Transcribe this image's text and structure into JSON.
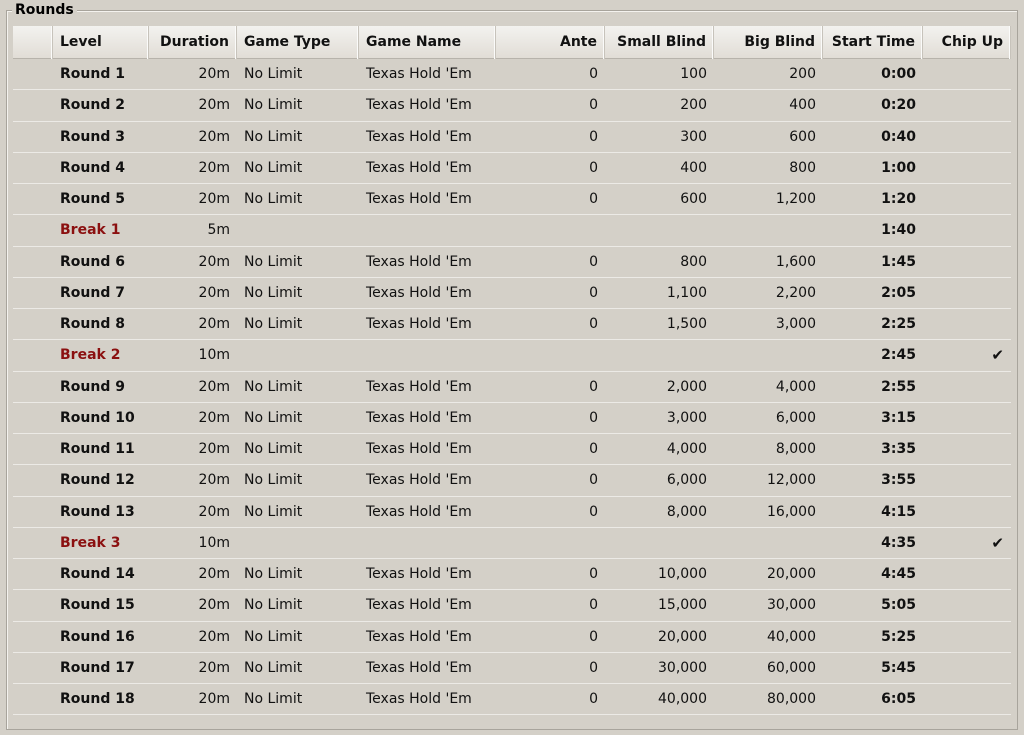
{
  "group": {
    "title": "Rounds"
  },
  "columns": {
    "level": "Level",
    "duration": "Duration",
    "game_type": "Game Type",
    "game_name": "Game Name",
    "ante": "Ante",
    "small_blind": "Small Blind",
    "big_blind": "Big Blind",
    "start_time": "Start Time",
    "chip_up": "Chip Up"
  },
  "check_glyph": "✔",
  "rows": [
    {
      "level": "Round 1",
      "type": "round",
      "duration": "20m",
      "game_type": "No Limit",
      "game_name": "Texas Hold 'Em",
      "ante": "0",
      "small_blind": "100",
      "big_blind": "200",
      "start_time": "0:00",
      "chip_up": false
    },
    {
      "level": "Round 2",
      "type": "round",
      "duration": "20m",
      "game_type": "No Limit",
      "game_name": "Texas Hold 'Em",
      "ante": "0",
      "small_blind": "200",
      "big_blind": "400",
      "start_time": "0:20",
      "chip_up": false
    },
    {
      "level": "Round 3",
      "type": "round",
      "duration": "20m",
      "game_type": "No Limit",
      "game_name": "Texas Hold 'Em",
      "ante": "0",
      "small_blind": "300",
      "big_blind": "600",
      "start_time": "0:40",
      "chip_up": false
    },
    {
      "level": "Round 4",
      "type": "round",
      "duration": "20m",
      "game_type": "No Limit",
      "game_name": "Texas Hold 'Em",
      "ante": "0",
      "small_blind": "400",
      "big_blind": "800",
      "start_time": "1:00",
      "chip_up": false
    },
    {
      "level": "Round 5",
      "type": "round",
      "duration": "20m",
      "game_type": "No Limit",
      "game_name": "Texas Hold 'Em",
      "ante": "0",
      "small_blind": "600",
      "big_blind": "1,200",
      "start_time": "1:20",
      "chip_up": false
    },
    {
      "level": "Break 1",
      "type": "break",
      "duration": "5m",
      "game_type": "",
      "game_name": "",
      "ante": "",
      "small_blind": "",
      "big_blind": "",
      "start_time": "1:40",
      "chip_up": false
    },
    {
      "level": "Round 6",
      "type": "round",
      "duration": "20m",
      "game_type": "No Limit",
      "game_name": "Texas Hold 'Em",
      "ante": "0",
      "small_blind": "800",
      "big_blind": "1,600",
      "start_time": "1:45",
      "chip_up": false
    },
    {
      "level": "Round 7",
      "type": "round",
      "duration": "20m",
      "game_type": "No Limit",
      "game_name": "Texas Hold 'Em",
      "ante": "0",
      "small_blind": "1,100",
      "big_blind": "2,200",
      "start_time": "2:05",
      "chip_up": false
    },
    {
      "level": "Round 8",
      "type": "round",
      "duration": "20m",
      "game_type": "No Limit",
      "game_name": "Texas Hold 'Em",
      "ante": "0",
      "small_blind": "1,500",
      "big_blind": "3,000",
      "start_time": "2:25",
      "chip_up": false
    },
    {
      "level": "Break 2",
      "type": "break",
      "duration": "10m",
      "game_type": "",
      "game_name": "",
      "ante": "",
      "small_blind": "",
      "big_blind": "",
      "start_time": "2:45",
      "chip_up": true
    },
    {
      "level": "Round 9",
      "type": "round",
      "duration": "20m",
      "game_type": "No Limit",
      "game_name": "Texas Hold 'Em",
      "ante": "0",
      "small_blind": "2,000",
      "big_blind": "4,000",
      "start_time": "2:55",
      "chip_up": false
    },
    {
      "level": "Round 10",
      "type": "round",
      "duration": "20m",
      "game_type": "No Limit",
      "game_name": "Texas Hold 'Em",
      "ante": "0",
      "small_blind": "3,000",
      "big_blind": "6,000",
      "start_time": "3:15",
      "chip_up": false
    },
    {
      "level": "Round 11",
      "type": "round",
      "duration": "20m",
      "game_type": "No Limit",
      "game_name": "Texas Hold 'Em",
      "ante": "0",
      "small_blind": "4,000",
      "big_blind": "8,000",
      "start_time": "3:35",
      "chip_up": false
    },
    {
      "level": "Round 12",
      "type": "round",
      "duration": "20m",
      "game_type": "No Limit",
      "game_name": "Texas Hold 'Em",
      "ante": "0",
      "small_blind": "6,000",
      "big_blind": "12,000",
      "start_time": "3:55",
      "chip_up": false
    },
    {
      "level": "Round 13",
      "type": "round",
      "duration": "20m",
      "game_type": "No Limit",
      "game_name": "Texas Hold 'Em",
      "ante": "0",
      "small_blind": "8,000",
      "big_blind": "16,000",
      "start_time": "4:15",
      "chip_up": false
    },
    {
      "level": "Break 3",
      "type": "break",
      "duration": "10m",
      "game_type": "",
      "game_name": "",
      "ante": "",
      "small_blind": "",
      "big_blind": "",
      "start_time": "4:35",
      "chip_up": true
    },
    {
      "level": "Round 14",
      "type": "round",
      "duration": "20m",
      "game_type": "No Limit",
      "game_name": "Texas Hold 'Em",
      "ante": "0",
      "small_blind": "10,000",
      "big_blind": "20,000",
      "start_time": "4:45",
      "chip_up": false
    },
    {
      "level": "Round 15",
      "type": "round",
      "duration": "20m",
      "game_type": "No Limit",
      "game_name": "Texas Hold 'Em",
      "ante": "0",
      "small_blind": "15,000",
      "big_blind": "30,000",
      "start_time": "5:05",
      "chip_up": false
    },
    {
      "level": "Round 16",
      "type": "round",
      "duration": "20m",
      "game_type": "No Limit",
      "game_name": "Texas Hold 'Em",
      "ante": "0",
      "small_blind": "20,000",
      "big_blind": "40,000",
      "start_time": "5:25",
      "chip_up": false
    },
    {
      "level": "Round 17",
      "type": "round",
      "duration": "20m",
      "game_type": "No Limit",
      "game_name": "Texas Hold 'Em",
      "ante": "0",
      "small_blind": "30,000",
      "big_blind": "60,000",
      "start_time": "5:45",
      "chip_up": false
    },
    {
      "level": "Round 18",
      "type": "round",
      "duration": "20m",
      "game_type": "No Limit",
      "game_name": "Texas Hold 'Em",
      "ante": "0",
      "small_blind": "40,000",
      "big_blind": "80,000",
      "start_time": "6:05",
      "chip_up": false
    }
  ]
}
